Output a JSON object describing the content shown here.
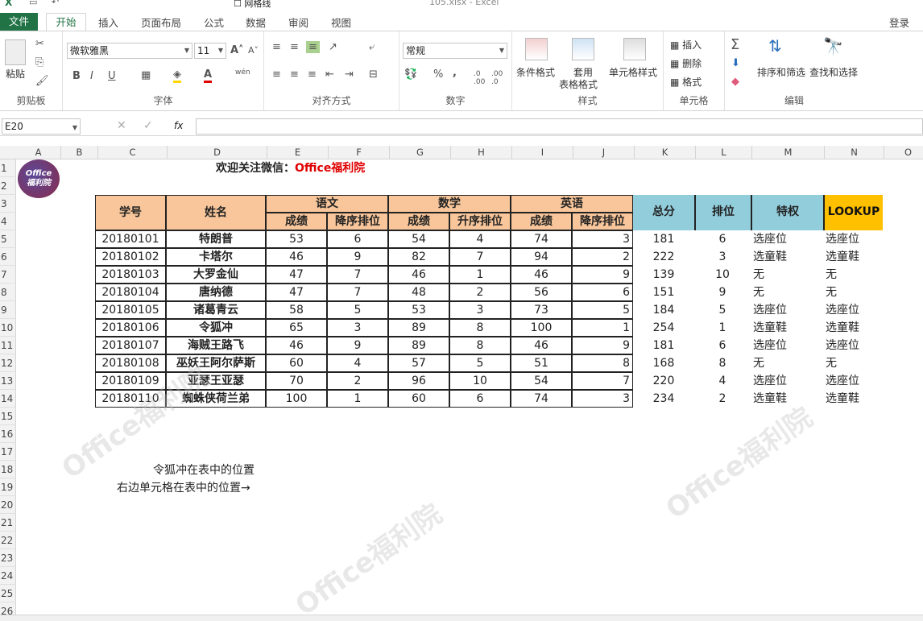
{
  "app": {
    "title": "105.xlsx - Excel",
    "show_gridlines_label": "网格线",
    "login": "登录"
  },
  "tabs": {
    "file": "文件",
    "home": "开始",
    "insert": "插入",
    "page_layout": "页面布局",
    "formulas": "公式",
    "data": "数据",
    "review": "审阅",
    "view": "视图"
  },
  "ribbon": {
    "clipboard": {
      "label": "剪贴板",
      "paste": "粘贴"
    },
    "font": {
      "label": "字体",
      "name": "微软雅黑",
      "size": "11",
      "bold": "B",
      "italic": "I",
      "underline": "U",
      "wen": "wén"
    },
    "alignment": {
      "label": "对齐方式"
    },
    "number": {
      "label": "数字",
      "format": "常规",
      "percent": "%",
      "comma": ","
    },
    "styles": {
      "label": "样式",
      "conditional": "条件格式",
      "table1": "套用",
      "table2": "表格格式",
      "cell_styles": "单元格样式"
    },
    "cells": {
      "label": "单元格",
      "insert": "插入",
      "delete": "删除",
      "format": "格式"
    },
    "editing": {
      "label": "编辑",
      "sort": "排序和筛选",
      "find": "查找和选择"
    }
  },
  "formula_bar": {
    "name_box": "E20",
    "fx": "fx",
    "formula": ""
  },
  "columns": [
    "A",
    "B",
    "C",
    "D",
    "E",
    "F",
    "G",
    "H",
    "I",
    "J",
    "K",
    "L",
    "M",
    "N",
    "O"
  ],
  "rows": [
    "1",
    "2",
    "3",
    "4",
    "5",
    "6",
    "7",
    "8",
    "9",
    "10",
    "11",
    "12",
    "13",
    "14",
    "15",
    "16",
    "17",
    "18",
    "19",
    "20",
    "21",
    "22",
    "23",
    "24",
    "25",
    "26"
  ],
  "sheet": {
    "logo_line1": "Office",
    "logo_line2": "福利院",
    "title_prefix": "欢迎关注微信：",
    "title_brand": "Office福利院",
    "headers": {
      "id": "学号",
      "name": "姓名",
      "chinese": "语文",
      "math": "数学",
      "english": "英语",
      "score": "成绩",
      "desc_rank": "降序排位",
      "asc_rank": "升序排位",
      "total": "总分",
      "rank": "排位",
      "privilege": "特权",
      "lookup": "LOOKUP"
    },
    "data": [
      [
        "20180101",
        "特朗普",
        "53",
        "6",
        "54",
        "4",
        "74",
        "3",
        "181",
        "6",
        "选座位",
        "选座位"
      ],
      [
        "20180102",
        "卡塔尔",
        "46",
        "9",
        "82",
        "7",
        "94",
        "2",
        "222",
        "3",
        "选童鞋",
        "选童鞋"
      ],
      [
        "20180103",
        "大罗金仙",
        "47",
        "7",
        "46",
        "1",
        "46",
        "9",
        "139",
        "10",
        "无",
        "无"
      ],
      [
        "20180104",
        "唐纳德",
        "47",
        "7",
        "48",
        "2",
        "56",
        "6",
        "151",
        "9",
        "无",
        "无"
      ],
      [
        "20180105",
        "诸葛青云",
        "58",
        "5",
        "53",
        "3",
        "73",
        "5",
        "184",
        "5",
        "选座位",
        "选座位"
      ],
      [
        "20180106",
        "令狐冲",
        "65",
        "3",
        "89",
        "8",
        "100",
        "1",
        "254",
        "1",
        "选童鞋",
        "选童鞋"
      ],
      [
        "20180107",
        "海贼王路飞",
        "46",
        "9",
        "89",
        "8",
        "46",
        "9",
        "181",
        "6",
        "选座位",
        "选座位"
      ],
      [
        "20180108",
        "巫妖王阿尔萨斯",
        "60",
        "4",
        "57",
        "5",
        "51",
        "8",
        "168",
        "8",
        "无",
        "无"
      ],
      [
        "20180109",
        "亚瑟王亚瑟",
        "70",
        "2",
        "96",
        "10",
        "54",
        "7",
        "220",
        "4",
        "选座位",
        "选座位"
      ],
      [
        "20180110",
        "蜘蛛侠荷兰弟",
        "100",
        "1",
        "60",
        "6",
        "74",
        "3",
        "234",
        "2",
        "选童鞋",
        "选童鞋"
      ]
    ],
    "note1": "令狐冲在表中的位置",
    "note2": "右边单元格在表中的位置→",
    "watermark": "Office福利院"
  },
  "colors": {
    "excel_green": "#217346",
    "header_orange": "#f8c69a",
    "header_blue": "#92cddc",
    "lookup_yellow": "#ffc000",
    "brand_red": "#e00000"
  }
}
